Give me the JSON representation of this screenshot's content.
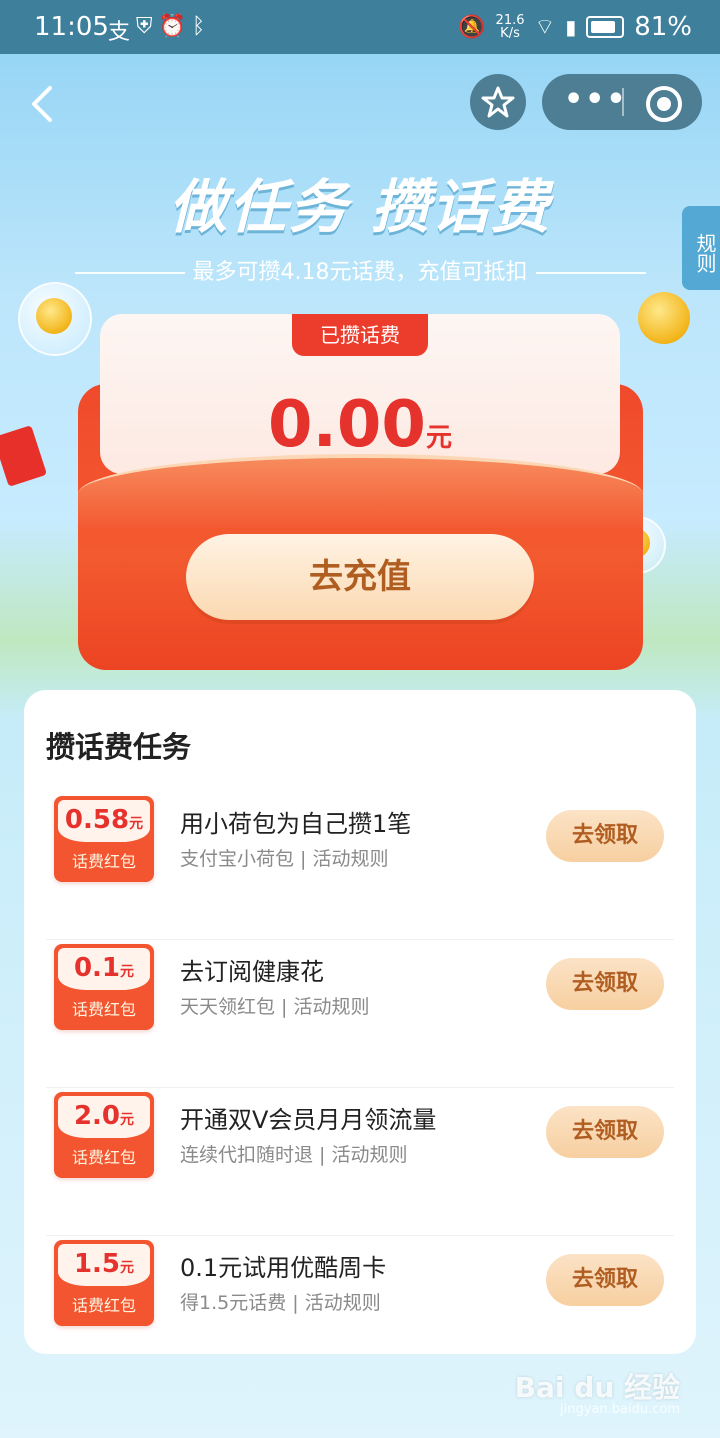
{
  "status_bar": {
    "time": "11:05",
    "network_speed_top": "21.6",
    "network_speed_bottom": "K/s",
    "battery": "81%"
  },
  "header": {
    "headline": "做任务 攒话费",
    "subline": "最多可攒4.18元话费，充值可抵扣",
    "rules_tab": "规则"
  },
  "envelope": {
    "tag": "已攒话费",
    "amount": "0.00",
    "unit": "元",
    "button": "去充值"
  },
  "tasks_section": {
    "title": "攒话费任务",
    "packet_label": "话费红包",
    "claim_label": "去领取",
    "items": [
      {
        "value": "0.58",
        "unit": "元",
        "title": "用小荷包为自己攒1笔",
        "subtitle": "支付宝小荷包 | 活动规则"
      },
      {
        "value": "0.1",
        "unit": "元",
        "title": "去订阅健康花",
        "subtitle": "天天领红包 | 活动规则"
      },
      {
        "value": "2.0",
        "unit": "元",
        "title": "开通双V会员月月领流量",
        "subtitle": "连续代扣随时退 | 活动规则"
      },
      {
        "value": "1.5",
        "unit": "元",
        "title": "0.1元试用优酷周卡",
        "subtitle": "得1.5元话费 | 活动规则"
      }
    ]
  },
  "watermark": {
    "text": "Bai du 经验",
    "sub": "jingyan.baidu.com"
  },
  "colors": {
    "status_bar": "#3e7f9b",
    "envelope_red": "#f04a2c",
    "amount_red": "#e5322c",
    "button_text": "#b05d21"
  }
}
